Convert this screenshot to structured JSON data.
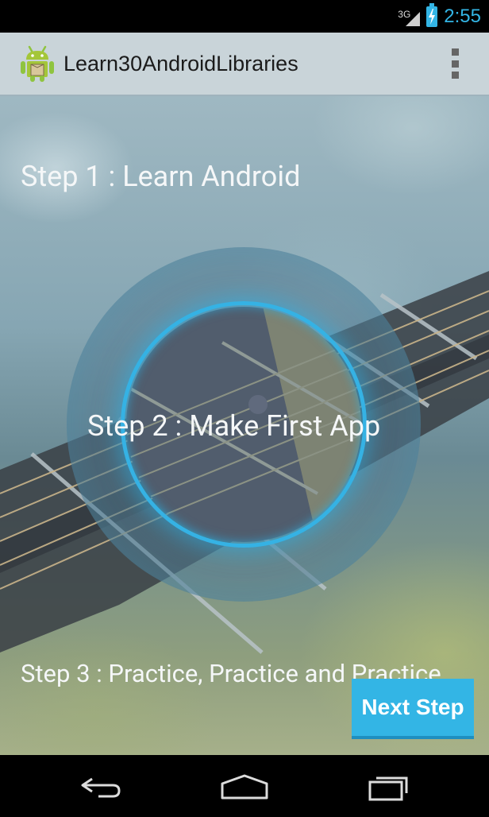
{
  "status_bar": {
    "network_label": "3G",
    "time": "2:55",
    "accent_color": "#33b5e5"
  },
  "action_bar": {
    "title": "Learn30AndroidLibraries",
    "app_icon": "android-robot-icon",
    "overflow_icon": "overflow-menu-icon"
  },
  "content": {
    "step1": "Step 1 : Learn Android",
    "step2": "Step 2 : Make First App",
    "step3": "Step 3 : Practice, Practice and Practice",
    "next_button": "Next Step"
  },
  "nav_bar": {
    "back_icon": "back-icon",
    "home_icon": "home-icon",
    "recents_icon": "recent-apps-icon"
  }
}
